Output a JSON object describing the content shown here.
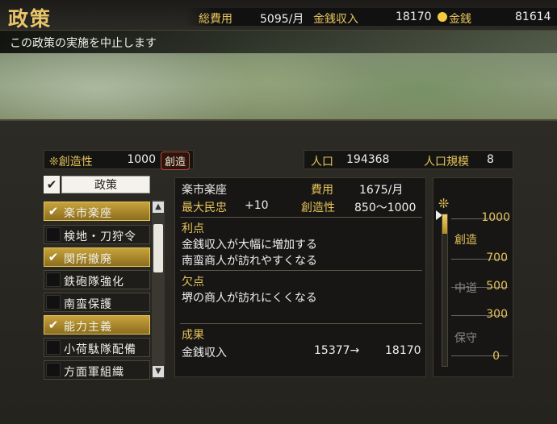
{
  "header": {
    "title": "政策",
    "total_cost_label": "総費用",
    "total_cost_value": "5095/月",
    "income_label": "金銭収入",
    "income_value": "18170",
    "money_label": "金銭",
    "money_value": "81614"
  },
  "subtitle": "この政策の実施を中止します",
  "creativity": {
    "label": "❊創造性",
    "value": "1000",
    "badge": "創造"
  },
  "population": {
    "label": "人口",
    "value": "194368",
    "scale_label": "人口規模",
    "scale_value": "8"
  },
  "policy_tab": {
    "label": "政策"
  },
  "policies": [
    {
      "label": "楽市楽座",
      "checked": true
    },
    {
      "label": "検地・刀狩令",
      "checked": false
    },
    {
      "label": "関所撤廃",
      "checked": true
    },
    {
      "label": "鉄砲隊強化",
      "checked": false
    },
    {
      "label": "南蛮保護",
      "checked": false
    },
    {
      "label": "能力主義",
      "checked": true
    },
    {
      "label": "小荷駄隊配備",
      "checked": false
    },
    {
      "label": "方面軍組織",
      "checked": false
    }
  ],
  "detail": {
    "name": "楽市楽座",
    "cost_label": "費用",
    "cost_value": "1675/月",
    "max_label": "最大民忠",
    "max_value": "+10",
    "req_label": "創造性",
    "req_value": "850～1000",
    "merit_title": "利点",
    "merits": [
      "金銭収入が大幅に増加する",
      "南蛮商人が訪れやすくなる"
    ],
    "demerit_title": "欠点",
    "demerits": [
      "堺の商人が訪れにくくなる"
    ],
    "result_title": "成果",
    "result_label": "金銭収入",
    "result_from": "15377→",
    "result_to": "18170"
  },
  "gauge": {
    "icon": "❊",
    "ticks": [
      "1000",
      "700",
      "500",
      "300",
      "0"
    ],
    "labels": [
      "創造",
      "中道",
      "保守"
    ],
    "level_fraction": 1.0
  },
  "colors": {
    "accent": "#e6c35a",
    "checked_bg": "#c8a33c",
    "badge_border": "#c04a2a"
  }
}
